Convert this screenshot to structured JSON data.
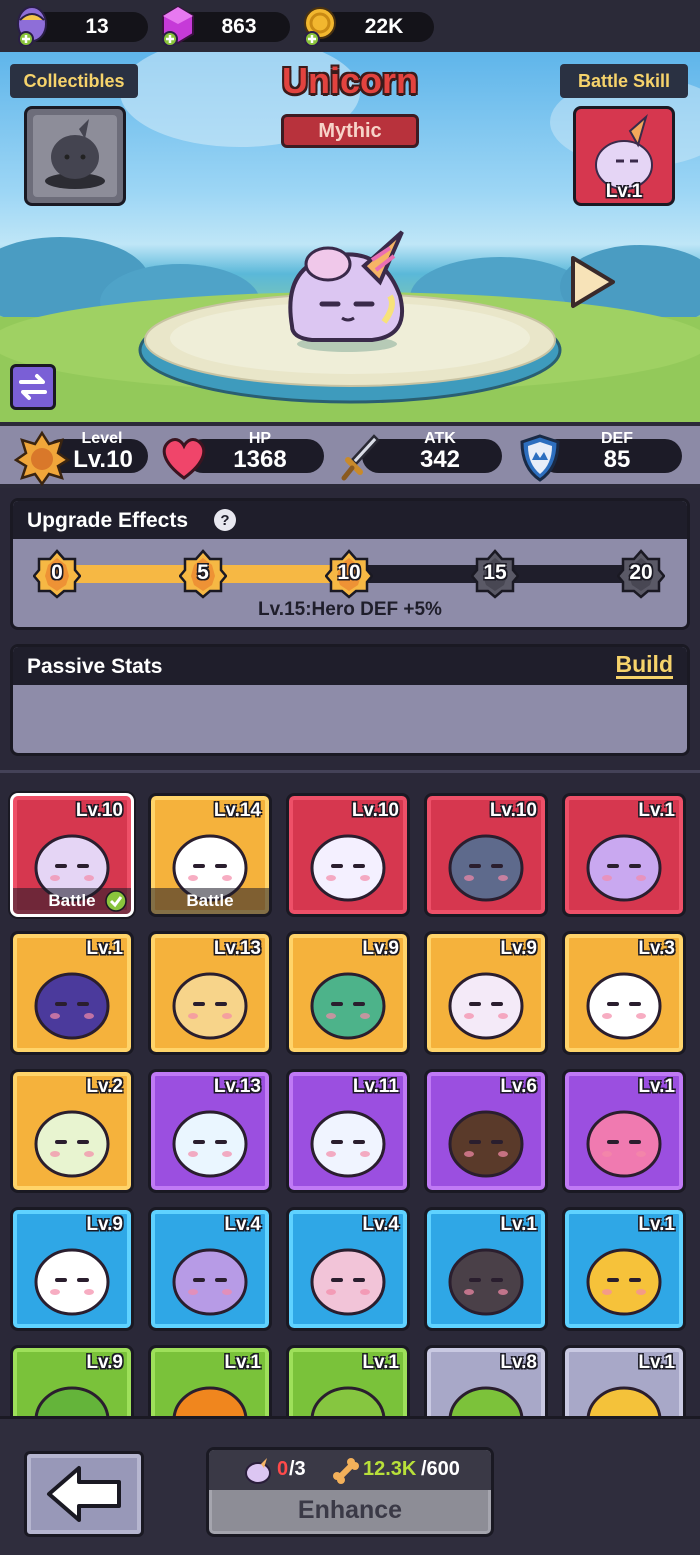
{
  "currencies": {
    "eggs": "13",
    "gems": "863",
    "coins": "22K"
  },
  "hero": {
    "name": "Unicorn",
    "rarity": "Mythic",
    "collectibles_label": "Collectibles",
    "battle_skill_label": "Battle Skill",
    "skill_level": "Lv.1"
  },
  "stats": {
    "level_label": "Level",
    "level_value": "Lv.10",
    "hp_label": "HP",
    "hp_value": "1368",
    "atk_label": "ATK",
    "atk_value": "342",
    "def_label": "DEF",
    "def_value": "85"
  },
  "upgrade": {
    "title": "Upgrade Effects",
    "milestones": [
      "0",
      "5",
      "10",
      "15",
      "20"
    ],
    "current_level": 10,
    "max_level": 20,
    "effect_text": "Lv.15:Hero DEF +5%"
  },
  "passive": {
    "title": "Passive Stats",
    "build_label": "Build"
  },
  "heroes": [
    {
      "level": "Lv.10",
      "rarity": "red",
      "icon": "unicorn-icon",
      "tag": "Battle",
      "selected": true
    },
    {
      "level": "Lv.14",
      "rarity": "gold",
      "icon": "blue-bird-icon",
      "tag": "Battle"
    },
    {
      "level": "Lv.10",
      "rarity": "red",
      "icon": "winged-cat-icon"
    },
    {
      "level": "Lv.10",
      "rarity": "red",
      "icon": "storm-cloud-icon"
    },
    {
      "level": "Lv.1",
      "rarity": "red",
      "icon": "king-slime-icon"
    },
    {
      "level": "Lv.1",
      "rarity": "gold",
      "icon": "purple-dragon-icon"
    },
    {
      "level": "Lv.13",
      "rarity": "gold",
      "icon": "ram-icon"
    },
    {
      "level": "Lv.9",
      "rarity": "gold",
      "icon": "cactus-boxer-icon"
    },
    {
      "level": "Lv.9",
      "rarity": "gold",
      "icon": "genie-icon"
    },
    {
      "level": "Lv.3",
      "rarity": "gold",
      "icon": "fox-icon"
    },
    {
      "level": "Lv.2",
      "rarity": "gold",
      "icon": "rainbow-mushroom-icon"
    },
    {
      "level": "Lv.13",
      "rarity": "purple",
      "icon": "snowman-icon"
    },
    {
      "level": "Lv.11",
      "rarity": "purple",
      "icon": "ice-crystal-icon"
    },
    {
      "level": "Lv.6",
      "rarity": "purple",
      "icon": "eagle-icon"
    },
    {
      "level": "Lv.1",
      "rarity": "purple",
      "icon": "pink-bird-icon"
    },
    {
      "level": "Lv.9",
      "rarity": "blue",
      "icon": "calico-cat-icon"
    },
    {
      "level": "Lv.4",
      "rarity": "blue",
      "icon": "spiky-mushroom-icon"
    },
    {
      "level": "Lv.4",
      "rarity": "blue",
      "icon": "pink-blob-icon"
    },
    {
      "level": "Lv.1",
      "rarity": "blue",
      "icon": "beetle-icon"
    },
    {
      "level": "Lv.1",
      "rarity": "blue",
      "icon": "chick-icon"
    },
    {
      "level": "Lv.9",
      "rarity": "green",
      "icon": "flower-slime-icon"
    },
    {
      "level": "Lv.1",
      "rarity": "green",
      "icon": "orange-icon"
    },
    {
      "level": "Lv.1",
      "rarity": "green",
      "icon": "frog-icon"
    },
    {
      "level": "Lv.8",
      "rarity": "gray",
      "icon": "parrot-icon"
    },
    {
      "level": "Lv.1",
      "rarity": "gray",
      "icon": "lemon-icon"
    }
  ],
  "enhance": {
    "shard_have": "0",
    "shard_need": "/3",
    "bone_have": "12.3K",
    "bone_need": "/600",
    "label": "Enhance"
  },
  "colors": {
    "red_card": "#d6374f",
    "gold_card": "#f5b23c",
    "purple_card": "#9b4fe0",
    "blue_card": "#2fa7e6",
    "green_card": "#7ac23a",
    "gray_card": "#a8a8c8",
    "progress_fill": "#f6b844"
  }
}
